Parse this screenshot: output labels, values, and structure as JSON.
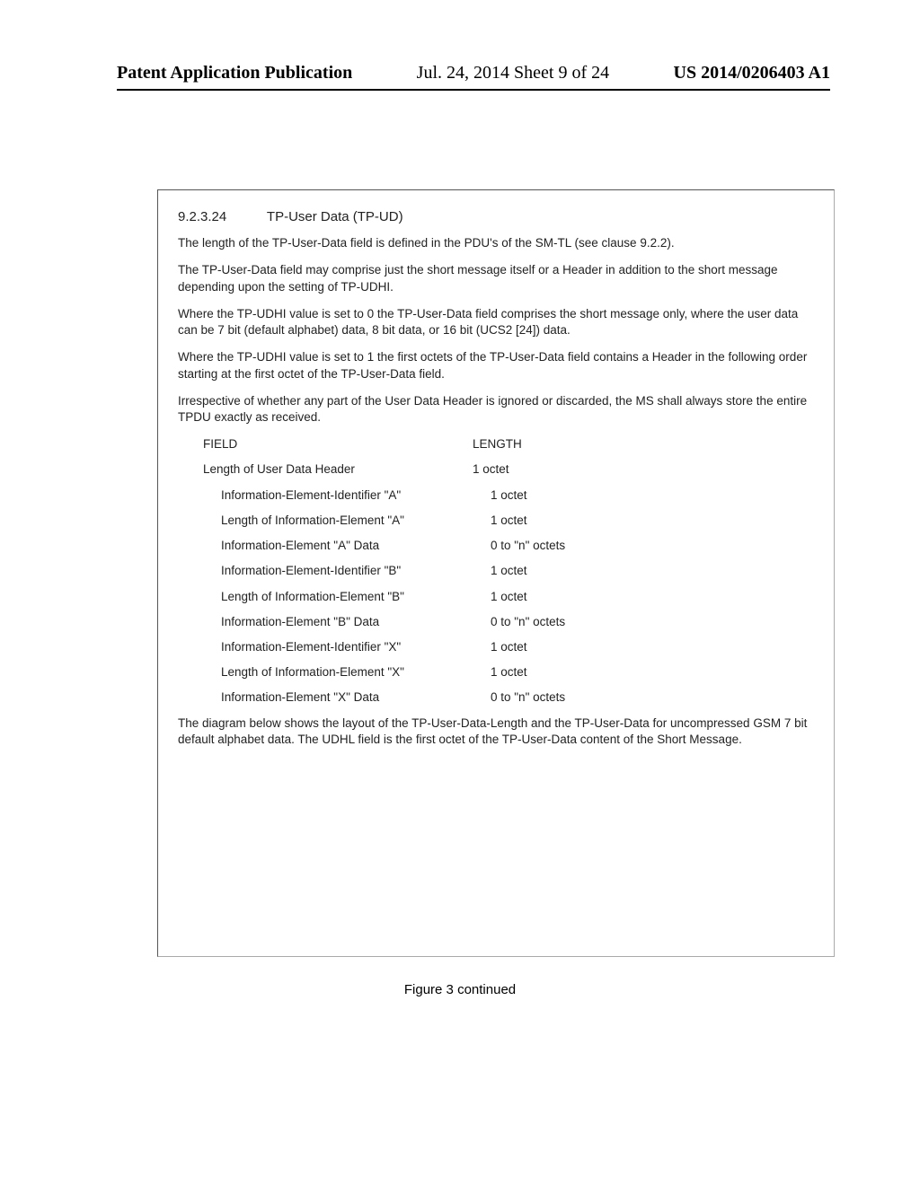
{
  "header": {
    "left": "Patent Application Publication",
    "middle": "Jul. 24, 2014  Sheet 9 of 24",
    "right": "US 2014/0206403 A1"
  },
  "section": {
    "number": "9.2.3.24",
    "title": "TP-User Data (TP-UD)"
  },
  "paragraphs": {
    "p1": "The length of the TP-User-Data field is defined in the PDU's of the SM-TL (see clause 9.2.2).",
    "p2": "The TP-User-Data field may comprise just the short message itself or a Header in addition to the short message depending upon the setting of TP-UDHI.",
    "p3": "Where the TP-UDHI value is set to 0 the TP-User-Data field comprises the short message only, where the user data can be 7 bit (default alphabet) data, 8 bit data, or 16 bit (UCS2 [24]) data.",
    "p4": "Where the TP-UDHI value is set to 1 the first octets of the TP-User-Data field contains a Header in the following order starting at the first octet of the TP-User-Data field.",
    "p5": "Irrespective of whether any part of the User Data Header is ignored or discarded, the MS shall always store the entire TPDU exactly as received.",
    "p6": "The diagram below shows the layout of the TP-User-Data-Length and the TP-User-Data for uncompressed GSM 7 bit default alphabet data. The UDHL field is the first octet of the TP-User-Data content of the Short Message."
  },
  "table": {
    "head": {
      "c1": "FIELD",
      "c2": "LENGTH"
    },
    "rows": [
      {
        "c1": "Length of User Data Header",
        "c2": "1 octet",
        "indent": false
      },
      {
        "c1": "Information-Element-Identifier \"A\"",
        "c2": "1 octet",
        "indent": true
      },
      {
        "c1": "Length of Information-Element \"A\"",
        "c2": "1 octet",
        "indent": true
      },
      {
        "c1": "Information-Element \"A\" Data",
        "c2": "0 to \"n\" octets",
        "indent": true
      },
      {
        "c1": "Information-Element-Identifier \"B\"",
        "c2": "1 octet",
        "indent": true
      },
      {
        "c1": "Length of Information-Element \"B\"",
        "c2": "1 octet",
        "indent": true
      },
      {
        "c1": "Information-Element \"B\" Data",
        "c2": "0 to \"n\" octets",
        "indent": true
      },
      {
        "c1": "Information-Element-Identifier \"X\"",
        "c2": "1 octet",
        "indent": true
      },
      {
        "c1": "Length of Information-Element \"X\"",
        "c2": "1 octet",
        "indent": true
      },
      {
        "c1": "Information-Element \"X\" Data",
        "c2": "0 to \"n\" octets",
        "indent": true
      }
    ]
  },
  "caption": "Figure 3 continued"
}
